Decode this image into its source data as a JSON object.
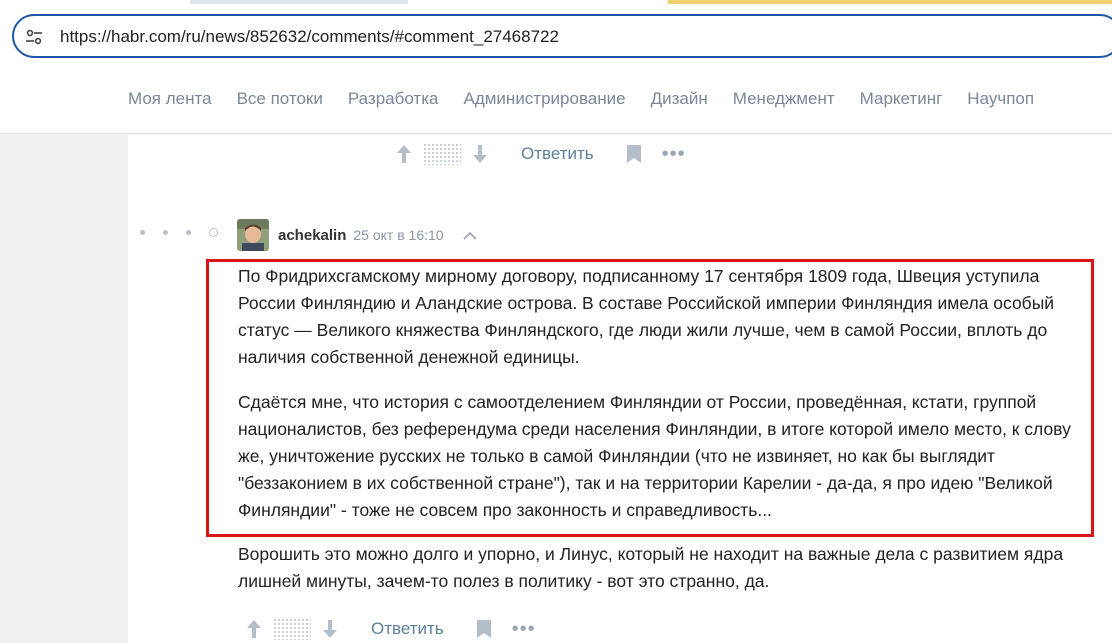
{
  "browser": {
    "url": "https://habr.com/ru/news/852632/comments/#comment_27468722"
  },
  "nav": {
    "items": [
      "Моя лента",
      "Все потоки",
      "Разработка",
      "Администрирование",
      "Дизайн",
      "Менеджмент",
      "Маркетинг",
      "Научпоп"
    ]
  },
  "prev_comment_actions": {
    "reply_label": "Ответить"
  },
  "comment": {
    "author": "achekalin",
    "time": "25 окт в 16:10",
    "paragraphs": [
      "По Фридрихсгамскому мирному договору, подписанному 17 сентября 1809 года, Швеция уступила России Финляндию и Аландские острова. В составе Российской империи Финляндия имела особый статус — Великого княжества Финляндского, где люди жили лучше, чем в самой России, вплоть до наличия собственной денежной единицы.",
      "Сдаётся мне, что история с самоотделением Финляндии от России, проведённая, кстати, группой националистов, без референдума среди населения Финляндии, в итоге которой имело место, к слову же, уничтожение русских не только в самой Финляндии (что не извиняет, но как бы выглядит \"беззаконием в их собственной стране\"), так и на территории Карелии - да-да, я про идею \"Великой Финляндии\" - тоже не совсем про законность и справедливость...",
      "Ворошить это можно долго и упорно, и Линус, который не находит на важные дела с развитием ядра лишней минуты, зачем-то полез в политику - вот это странно, да."
    ],
    "reply_label": "Ответить"
  },
  "colors": {
    "highlight_border": "#d9141b",
    "accent_link": "#5e7f9c",
    "omnibox_border": "#1e57a8"
  }
}
